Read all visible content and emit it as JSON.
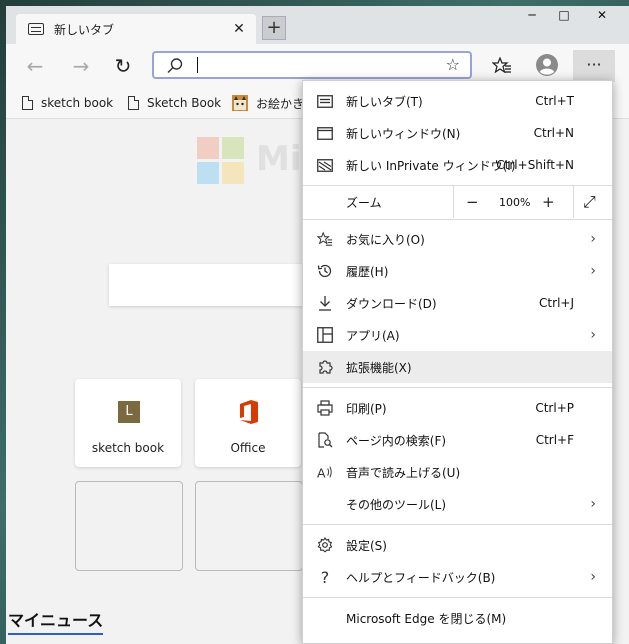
{
  "tab": {
    "title": "新しいタブ",
    "close": "✕"
  },
  "window": {
    "minimize": "─",
    "maximize": "□",
    "close": "✕"
  },
  "toolbar": {
    "back": "←",
    "forward": "→",
    "refresh": "↻",
    "search_icon": "⌕",
    "star": "☆",
    "favorites_icon": "☆",
    "profile_icon": "avatar",
    "more": "···",
    "new_tab": "+"
  },
  "favorites": [
    "sketch book",
    "Sketch Book",
    "お絵かき掲"
  ],
  "page": {
    "logo_text": "Mi",
    "tiles": [
      {
        "label": "sketch book",
        "letter": "L",
        "color": "#7b6a3f"
      },
      {
        "label": "Office",
        "color": "#d83b01"
      }
    ],
    "my_news": "マイニュース"
  },
  "menu": {
    "new_tab": {
      "label": "新しいタブ(T)",
      "shortcut": "Ctrl+T"
    },
    "new_window": {
      "label": "新しいウィンドウ(N)",
      "shortcut": "Ctrl+N"
    },
    "new_private": {
      "label": "新しい InPrivate ウィンドウ(I)",
      "shortcut": "Ctrl+Shift+N"
    },
    "zoom": {
      "label": "ズーム",
      "minus": "−",
      "value": "100%",
      "plus": "+",
      "fullscreen": "⤢"
    },
    "favorites": {
      "label": "お気に入り(O)"
    },
    "history": {
      "label": "履歴(H)"
    },
    "downloads": {
      "label": "ダウンロード(D)",
      "shortcut": "Ctrl+J"
    },
    "apps": {
      "label": "アプリ(A)"
    },
    "extensions": {
      "label": "拡張機能(X)"
    },
    "print": {
      "label": "印刷(P)",
      "shortcut": "Ctrl+P"
    },
    "find": {
      "label": "ページ内の検索(F)",
      "shortcut": "Ctrl+F"
    },
    "read_aloud": {
      "label": "音声で読み上げる(U)"
    },
    "more_tools": {
      "label": "その他のツール(L)"
    },
    "settings": {
      "label": "設定(S)"
    },
    "help": {
      "label": "ヘルプとフィードバック(B)"
    },
    "close_edge": {
      "label": "Microsoft Edge を閉じる(M)"
    },
    "chevron": "›"
  },
  "colors": {
    "accent": "#2b5ec9",
    "menu_hover": "#ececec",
    "office": "#d83b01",
    "sketch": "#7b6a3f"
  }
}
